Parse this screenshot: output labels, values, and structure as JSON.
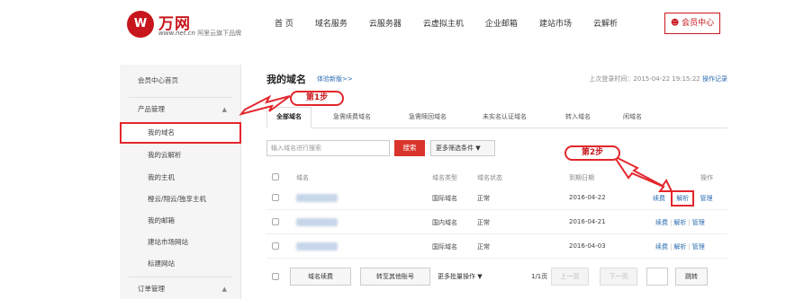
{
  "header": {
    "logo_badge": "W",
    "logo_name": "万网",
    "logo_domain": "www.net.cn",
    "logo_tagline": "阿里云旗下品牌",
    "nav": [
      "首 页",
      "域名服务",
      "云服务器",
      "云虚拟主机",
      "企业邮箱",
      "建站市场",
      "云解析"
    ],
    "member_center": "会员中心"
  },
  "sidebar": {
    "home": "会员中心首页",
    "product_group": "产品管理",
    "items": [
      "我的域名",
      "我的云解析",
      "我的主机",
      "橙云/翔云/独享主机",
      "我的邮箱",
      "建站市场网站",
      "标建网站"
    ],
    "order_group": "订单管理"
  },
  "main": {
    "title": "我的域名",
    "title_link": "体验新版>>",
    "last_login_label": "上次登录时间：2015-04-22 19:15:22",
    "login_log": "操作记录",
    "tabs": [
      "全部域名",
      "急需续费域名",
      "急需赎回域名",
      "未实名认证域名",
      "转入域名",
      "闲域名"
    ],
    "search": {
      "placeholder": "输入域名进行搜索",
      "button": "搜索",
      "more_filters": "更多筛选条件 ▼"
    },
    "table": {
      "headers": {
        "domain": "域名",
        "type": "域名类型",
        "status": "域名状态",
        "expiry": "到期日期",
        "actions": "操作"
      },
      "rows": [
        {
          "type": "国际域名",
          "status": "正常",
          "expiry": "2016-04-22",
          "renew": "续费",
          "resolve": "解析",
          "manage": "管理"
        },
        {
          "type": "国内域名",
          "status": "正常",
          "expiry": "2016-04-21",
          "renew": "续费",
          "resolve": "解析",
          "manage": "管理"
        },
        {
          "type": "国际域名",
          "status": "正常",
          "expiry": "2016-04-03",
          "renew": "续费",
          "resolve": "解析",
          "manage": "管理"
        }
      ]
    },
    "footer": {
      "renew_btn": "域名续费",
      "transfer_btn": "转至其他账号",
      "more_ops": "更多批量操作 ▼",
      "page_info": "1/1页",
      "prev": "上一页",
      "next": "下一页",
      "jump": "跳转"
    }
  },
  "annotations": {
    "step1": "第1步",
    "step2": "第2步"
  },
  "colors": {
    "brand_red": "#c8161d",
    "annotation_red": "#e3262c",
    "link_blue": "#2b6cb0",
    "search_red": "#d9342b"
  }
}
